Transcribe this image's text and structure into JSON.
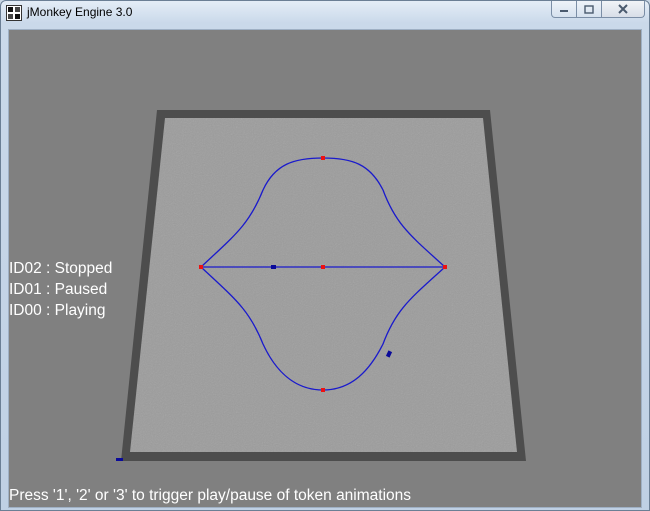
{
  "window": {
    "title": "jMonkey Engine 3.0",
    "icon": "jmonkey-app-icon",
    "controls": [
      "minimize-icon",
      "maximize-icon",
      "close-icon"
    ]
  },
  "scene": {
    "background_color": "#808080",
    "floor_color": "#9a9a9a",
    "floor_border_color": "#4a4a4a",
    "path_color": "#1a1acc",
    "control_point_color": "#ee1111",
    "token_color": "#0a0a99"
  },
  "status": {
    "lines": [
      "ID02 : Stopped",
      "ID01 : Paused",
      "ID00 : Playing"
    ]
  },
  "hint": {
    "text": "Press '1', '2' or '3' to trigger play/pause of token animations"
  }
}
